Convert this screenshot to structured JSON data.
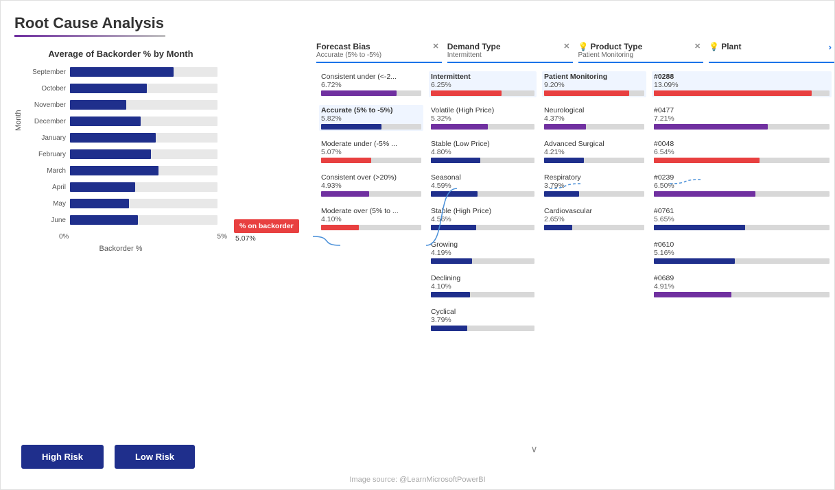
{
  "title": "Root Cause Analysis",
  "left_chart": {
    "title": "Average of Backorder % by Month",
    "y_axis_label": "Month",
    "x_axis_label": "Backorder %",
    "x_ticks": [
      "0%",
      "5%"
    ],
    "bars": [
      {
        "label": "September",
        "value": 70,
        "max": 100
      },
      {
        "label": "October",
        "value": 52,
        "max": 100
      },
      {
        "label": "November",
        "value": 38,
        "max": 100
      },
      {
        "label": "December",
        "value": 48,
        "max": 100
      },
      {
        "label": "January",
        "value": 58,
        "max": 100
      },
      {
        "label": "February",
        "value": 55,
        "max": 100
      },
      {
        "label": "March",
        "value": 60,
        "max": 100
      },
      {
        "label": "April",
        "value": 44,
        "max": 100
      },
      {
        "label": "May",
        "value": 40,
        "max": 100
      },
      {
        "label": "June",
        "value": 46,
        "max": 100
      }
    ]
  },
  "buttons": [
    {
      "label": "High Risk",
      "id": "high-risk"
    },
    {
      "label": "Low Risk",
      "id": "low-risk"
    }
  ],
  "filters": [
    {
      "title": "Forecast Bias",
      "value": "Accurate (5% to -5%)",
      "has_close": true,
      "has_bulb": false,
      "col_idx": 0
    },
    {
      "title": "Demand Type",
      "value": "Intermittent",
      "has_close": true,
      "has_bulb": false,
      "col_idx": 1
    },
    {
      "title": "Product Type",
      "value": "Patient Monitoring",
      "has_close": true,
      "has_bulb": true,
      "col_idx": 2
    },
    {
      "title": "Plant",
      "value": "",
      "has_close": false,
      "has_bulb": true,
      "col_idx": 3
    }
  ],
  "source_node": {
    "label": "% on backorder",
    "value": "5.07%"
  },
  "forecast_bias_col": {
    "items": [
      {
        "label": "Consistent under (<-2...",
        "value": "6.72%",
        "bar_pct": 75,
        "bar_color": "purple",
        "highlighted": false
      },
      {
        "label": "Accurate (5% to -5%)",
        "value": "5.82%",
        "bar_pct": 60,
        "bar_color": "blue",
        "highlighted": true
      },
      {
        "label": "Moderate under (-5% ...",
        "value": "5.07%",
        "bar_pct": 50,
        "bar_color": "red",
        "highlighted": false
      },
      {
        "label": "Consistent over (>20%)",
        "value": "4.93%",
        "bar_pct": 48,
        "bar_color": "purple",
        "highlighted": false
      },
      {
        "label": "Moderate over (5% to ...",
        "value": "4.10%",
        "bar_pct": 38,
        "bar_color": "red",
        "highlighted": false
      }
    ]
  },
  "demand_type_col": {
    "items": [
      {
        "label": "Intermittent",
        "value": "6.25%",
        "bar_pct": 68,
        "bar_color": "red",
        "highlighted": true
      },
      {
        "label": "Volatile (High Price)",
        "value": "5.32%",
        "bar_pct": 55,
        "bar_color": "purple",
        "highlighted": false
      },
      {
        "label": "Stable (Low Price)",
        "value": "4.80%",
        "bar_pct": 48,
        "bar_color": "blue",
        "highlighted": false
      },
      {
        "label": "Seasonal",
        "value": "4.59%",
        "bar_pct": 45,
        "bar_color": "blue",
        "highlighted": false
      },
      {
        "label": "Stable (High Price)",
        "value": "4.56%",
        "bar_pct": 44,
        "bar_color": "blue",
        "highlighted": false
      },
      {
        "label": "Growing",
        "value": "4.19%",
        "bar_pct": 40,
        "bar_color": "blue",
        "highlighted": false
      },
      {
        "label": "Declining",
        "value": "4.10%",
        "bar_pct": 38,
        "bar_color": "blue",
        "highlighted": false
      },
      {
        "label": "Cyclical",
        "value": "3.79%",
        "bar_pct": 35,
        "bar_color": "blue",
        "highlighted": false
      }
    ]
  },
  "product_type_col": {
    "items": [
      {
        "label": "Patient Monitoring",
        "value": "9.20%",
        "bar_pct": 85,
        "bar_color": "red",
        "highlighted": true
      },
      {
        "label": "Neurological",
        "value": "4.37%",
        "bar_pct": 42,
        "bar_color": "purple",
        "highlighted": false
      },
      {
        "label": "Advanced Surgical",
        "value": "4.21%",
        "bar_pct": 40,
        "bar_color": "blue",
        "highlighted": false
      },
      {
        "label": "Respiratory",
        "value": "3.79%",
        "bar_pct": 35,
        "bar_color": "blue",
        "highlighted": false
      },
      {
        "label": "Cardiovascular",
        "value": "2.65%",
        "bar_pct": 28,
        "bar_color": "blue",
        "highlighted": false
      }
    ]
  },
  "plant_col": {
    "items": [
      {
        "label": "#0288",
        "value": "13.09%",
        "bar_pct": 90,
        "bar_color": "red",
        "highlighted": true
      },
      {
        "label": "#0477",
        "value": "7.21%",
        "bar_pct": 65,
        "bar_color": "purple",
        "highlighted": false
      },
      {
        "label": "#0048",
        "value": "6.54%",
        "bar_pct": 60,
        "bar_color": "red",
        "highlighted": false
      },
      {
        "label": "#0239",
        "value": "6.50%",
        "bar_pct": 58,
        "bar_color": "purple",
        "highlighted": false
      },
      {
        "label": "#0761",
        "value": "5.65%",
        "bar_pct": 52,
        "bar_color": "blue",
        "highlighted": false
      },
      {
        "label": "#0610",
        "value": "5.16%",
        "bar_pct": 46,
        "bar_color": "blue",
        "highlighted": false
      },
      {
        "label": "#0689",
        "value": "4.91%",
        "bar_pct": 44,
        "bar_color": "purple",
        "highlighted": false
      }
    ]
  },
  "footer": "Image source: @LearnMicrosoftPowerBI",
  "down_arrow": "∨"
}
